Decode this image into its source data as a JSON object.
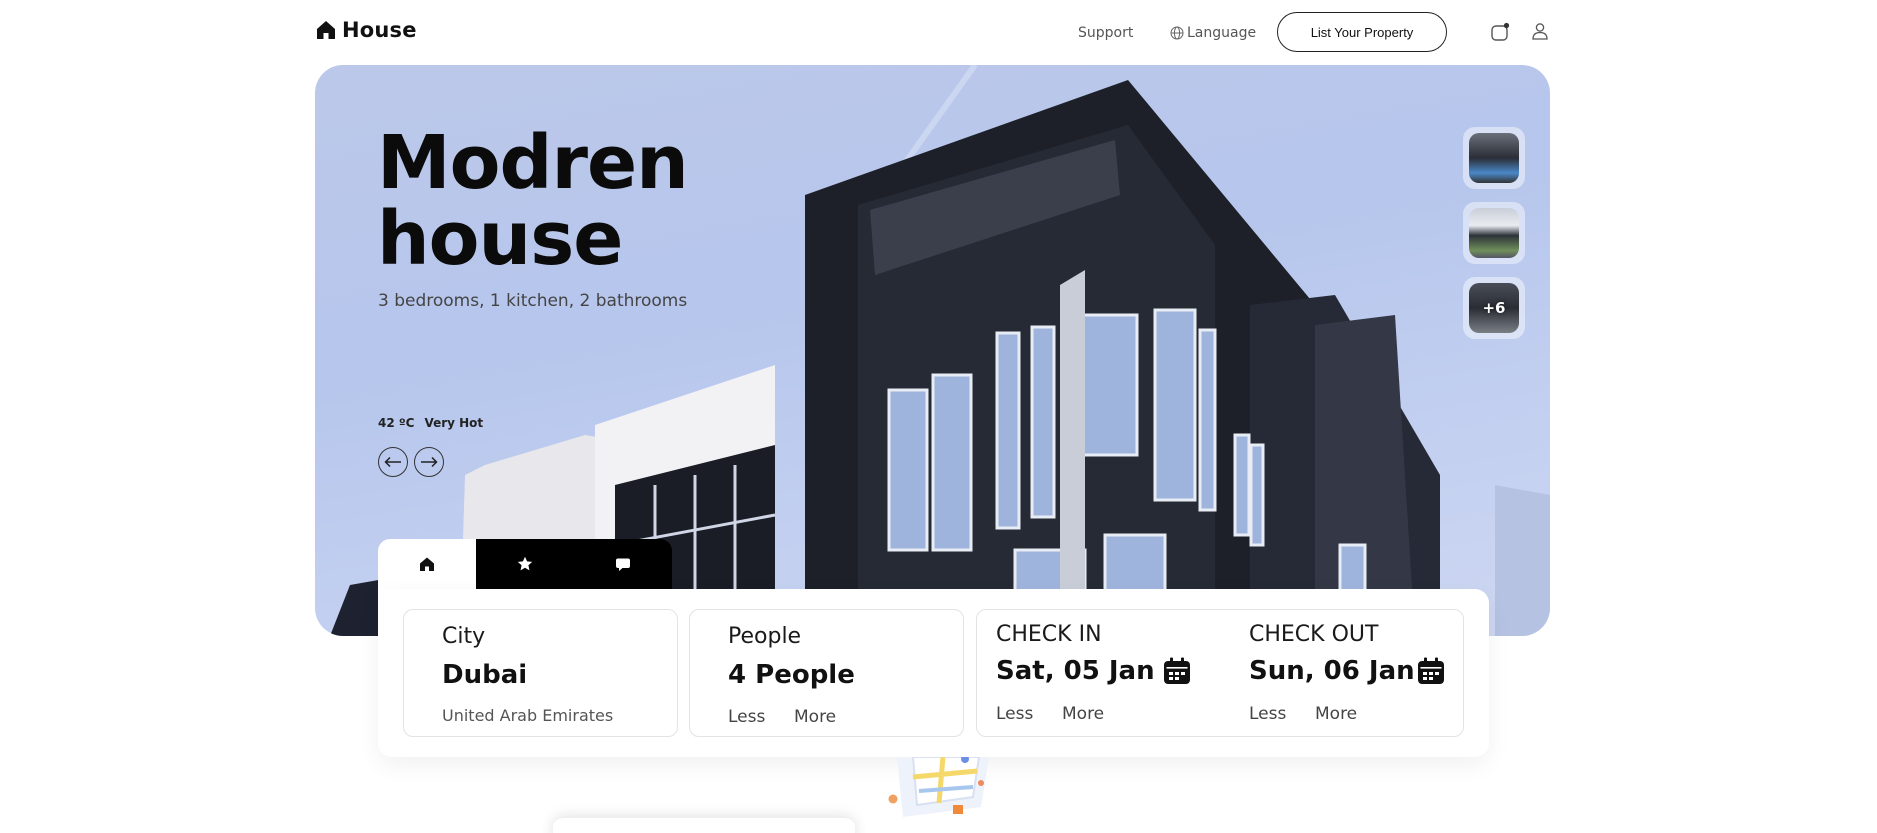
{
  "header": {
    "logo_text": "House",
    "nav": {
      "support": "Support",
      "language": "Language"
    },
    "list_property": "List Your Property"
  },
  "hero": {
    "title_line1": "Modren",
    "title_line2": "house",
    "subtitle": "3 bedrooms, 1 kitchen, 2 bathrooms",
    "temperature": "42 ºC",
    "weather_status": "Very Hot",
    "thumbnail_more": "+6"
  },
  "search": {
    "tabs": [
      {
        "icon": "home-icon",
        "active": true
      },
      {
        "icon": "star-icon",
        "active": false
      },
      {
        "icon": "chat-icon",
        "active": false
      }
    ],
    "city": {
      "label": "City",
      "value": "Dubai",
      "note": "United Arab Emirates"
    },
    "people": {
      "label": "People",
      "value": "4 People",
      "less": "Less",
      "more": "More"
    },
    "check_in": {
      "label": "CHECK IN",
      "value": "Sat, 05 Jan",
      "less": "Less",
      "more": "More"
    },
    "check_out": {
      "label": "CHECK OUT",
      "value": "Sun, 06 Jan",
      "less": "Less",
      "more": "More"
    }
  },
  "colors": {
    "accent": "#000000",
    "hero_sky": "#bcc8ea"
  }
}
